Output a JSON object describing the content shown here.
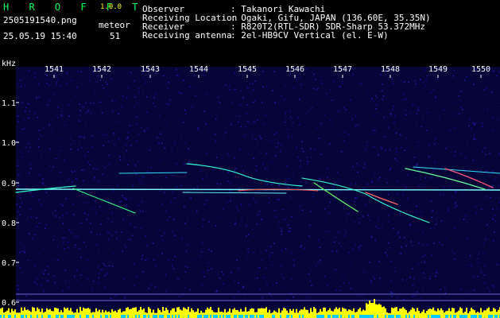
{
  "header": {
    "app_name": "H R O F F T",
    "version": "1.0.0",
    "filename": "2505191540.png",
    "datetime": "25.05.19 15:40",
    "count_label": "meteor",
    "count_value": "51",
    "info": [
      {
        "key": "Observer",
        "value": ": Takanori Kawachi"
      },
      {
        "key": "Receiving Location",
        "value": ": Ogaki, Gifu, JAPAN (136.60E, 35.35N)"
      },
      {
        "key": "Receiver",
        "value": ": R820T2(RTL-SDR) SDR-Sharp 53.372MHz"
      },
      {
        "key": "Receiving antenna",
        "value": ": 2el-HB9CV Vertical (el. E-W)"
      }
    ]
  },
  "axes": {
    "y_unit": "kHz",
    "x_ticks": [
      "1541",
      "1542",
      "1543",
      "1544",
      "1545",
      "1546",
      "1547",
      "1548",
      "1549",
      "1550"
    ],
    "y_ticks": [
      "1.1",
      "1.0",
      "0.9",
      "0.8",
      "0.7",
      "0.6"
    ]
  },
  "colors": {
    "background": "#000000",
    "header_text": "#ffffff",
    "accent_yellow": "#ffff00",
    "accent_green": "#00ff55",
    "spectrogram_noise": "#0a0a5a",
    "signal_cyan": "#00ffff",
    "signal_red": "#ff3333",
    "level_bar": "#ffff00"
  }
}
